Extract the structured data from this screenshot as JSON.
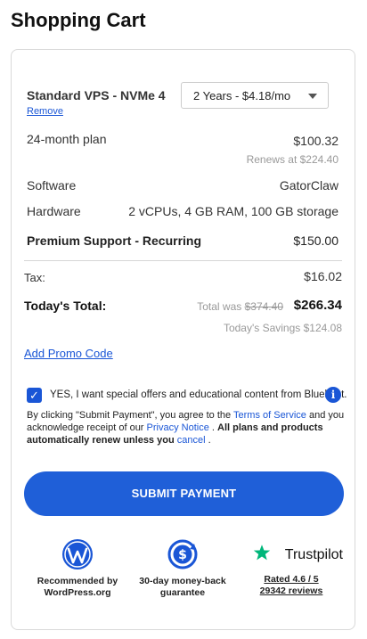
{
  "page": {
    "title": "Shopping Cart"
  },
  "product": {
    "name": "Standard VPS - NVMe 4",
    "remove_label": "Remove",
    "term_selected": "2 Years - $4.18/mo"
  },
  "line_items": {
    "plan_label": "24-month plan",
    "plan_price": "$100.32",
    "renews_text": "Renews at $224.40",
    "software_label": "Software",
    "software_value": "GatorClaw",
    "hardware_label": "Hardware",
    "hardware_value": "2 vCPUs, 4 GB RAM, 100 GB storage",
    "support_label": "Premium Support - Recurring",
    "support_price": "$150.00"
  },
  "totals": {
    "tax_label": "Tax:",
    "tax_value": "$16.02",
    "today_label": "Today's Total:",
    "was_prefix": "Total was",
    "was_value": "$374.40",
    "today_value": "$266.34",
    "savings_text": "Today's Savings $124.08"
  },
  "promo": {
    "label": "Add Promo Code"
  },
  "optin": {
    "checked": true,
    "label": "YES, I want special offers and educational content from Bluehost."
  },
  "legal": {
    "part1": "By clicking \"Submit Payment\", you agree to the ",
    "tos": "Terms of Service",
    "part2": " and you acknowledge receipt of our ",
    "privacy": "Privacy Notice",
    "part3": " .  ",
    "renew_bold": "All plans and products automatically renew unless you",
    "cancel": "cancel",
    "part4": " ."
  },
  "submit": {
    "label": "SUBMIT PAYMENT"
  },
  "badges": {
    "wordpress_line1": "Recommended by",
    "wordpress_line2": "WordPress.org",
    "guarantee_line1": "30-day money-back",
    "guarantee_line2": "guarantee",
    "trustpilot_name": "Trustpilot",
    "trustpilot_rating": "Rated 4.6 / 5",
    "trustpilot_reviews": "29342 reviews"
  },
  "colors": {
    "accent": "#1a56d6",
    "button": "#1f5fd8",
    "trustpilot_green": "#00b67a"
  }
}
